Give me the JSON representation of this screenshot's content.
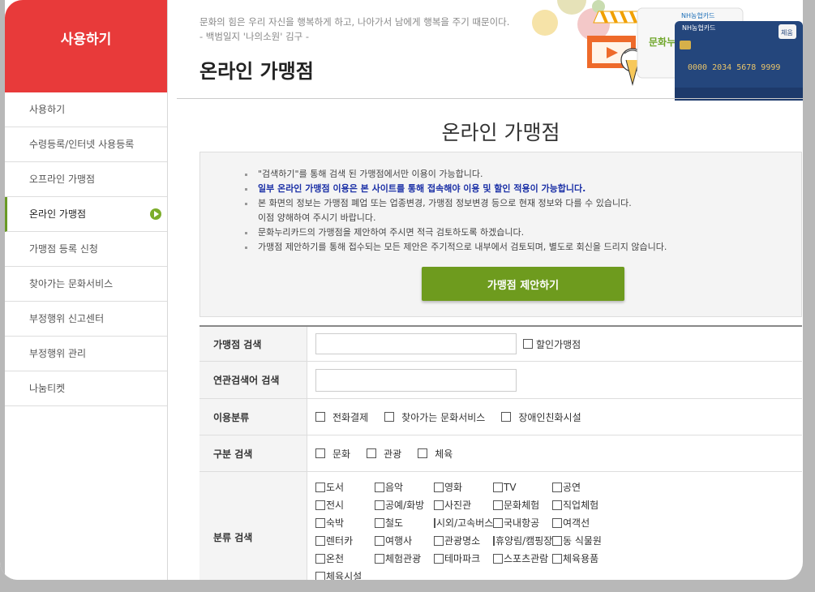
{
  "sidebar": {
    "heading": "사용하기",
    "items": [
      {
        "label": "사용하기"
      },
      {
        "label": "수령등록/인터넷 사용등록"
      },
      {
        "label": "오프라인 가맹점"
      },
      {
        "label": "온라인 가맹점"
      },
      {
        "label": "가맹점 등록 신청"
      },
      {
        "label": "찾아가는 문화서비스"
      },
      {
        "label": "부정행위 신고센터"
      },
      {
        "label": "부정행위 관리"
      },
      {
        "label": "나눔티켓"
      }
    ],
    "active_index": 3
  },
  "header": {
    "quote_line1": "문화의 힘은 우리 자신을 행복하게 하고, 나아가서 남에게 행복을 주기 때문이다.",
    "quote_line2": "- 백범일지 '나의소원' 김구 -",
    "title": "온라인 가맹점",
    "card_bank": "NH농협카드",
    "card_number": "0000 2034 5678 9999",
    "card_brand_small": "문화누리",
    "card_tag": "체움"
  },
  "main": {
    "section_title": "온라인 가맹점",
    "notices": [
      "\"검색하기\"를 통해 검색 된 가맹점에서만 이용이 가능합니다.",
      "일부 온라인 가맹점 이용은 본 사이트를 통해 접속해야 이용 및 할인 적용이 가능합니다.",
      "본 화면의 정보는 가맹점 폐업 또는 업종변경, 가맹점 정보변경 등으로 현재 정보와 다를 수 있습니다.",
      "이점 양해하여 주시기 바랍니다.",
      "문화누리카드의 가맹점을 제안하여 주시면 적극 검토하도록 하겠습니다.",
      "가맹점 제안하기를 통해 접수되는 모든 제안은 주기적으로 내부에서 검토되며, 별도로 회신을 드리지 않습니다."
    ],
    "propose_button": "가맹점 제안하기"
  },
  "search": {
    "merchant_label": "가맹점 검색",
    "merchant_value": "",
    "discount_label": "할인가맹점",
    "related_label": "연관검색어 검색",
    "related_value": "",
    "usage_label": "이용분류",
    "usage_options": [
      "전화결제",
      "찾아가는 문화서비스",
      "장애인친화시설"
    ],
    "division_label": "구분 검색",
    "division_options": [
      "문화",
      "관광",
      "체육"
    ],
    "category_label": "분류 검색",
    "categories": [
      "도서",
      "음악",
      "영화",
      "TV",
      "공연",
      "전시",
      "공예/화방",
      "사진관",
      "문화체험",
      "직업체험",
      "숙박",
      "철도",
      "시외/고속버스",
      "국내항공",
      "여객선",
      "렌터카",
      "여행사",
      "관광명소",
      "휴양림/캠핑장",
      "동 식물원",
      "온천",
      "체험관광",
      "테마파크",
      "스포츠관람",
      "체육용품",
      "체육시설"
    ]
  },
  "colors": {
    "sidebar_header": "#e83a3a",
    "accent_green": "#6e9b1e",
    "highlight_blue": "#1a2fa6"
  }
}
